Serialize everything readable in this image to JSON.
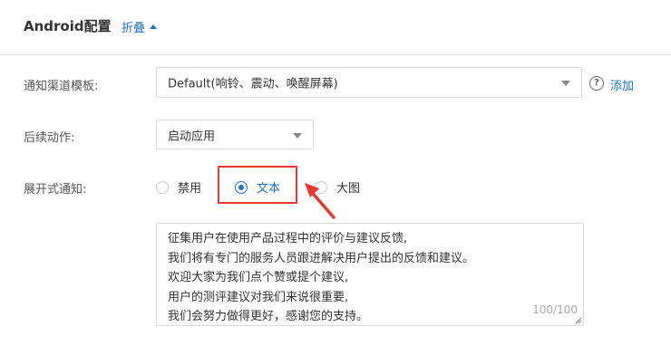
{
  "header": {
    "title": "Android配置",
    "collapse_label": "折叠"
  },
  "channel_template": {
    "label": "通知渠道模板:",
    "value": "Default(响铃、震动、唤醒屏幕)",
    "add_label": "添加"
  },
  "follow_action": {
    "label": "后续动作:",
    "value": "启动应用"
  },
  "expand_notice": {
    "label": "展开式通知:",
    "options": [
      {
        "label": "禁用",
        "selected": false
      },
      {
        "label": "文本",
        "selected": true
      },
      {
        "label": "大图",
        "selected": false
      }
    ]
  },
  "text_content": {
    "lines": [
      "征集用户在使用产品过程中的评价与建议反馈,",
      "我们将有专门的服务人员跟进解决用户提出的反馈和建议。",
      "欢迎大家为我们点个赞或提个建议,",
      "用户的测评建议对我们来说很重要,",
      "我们会努力做得更好，感谢您的支持。"
    ],
    "counter": "100/100"
  },
  "colors": {
    "accent": "#1a73c8",
    "highlight": "#e8382f"
  }
}
